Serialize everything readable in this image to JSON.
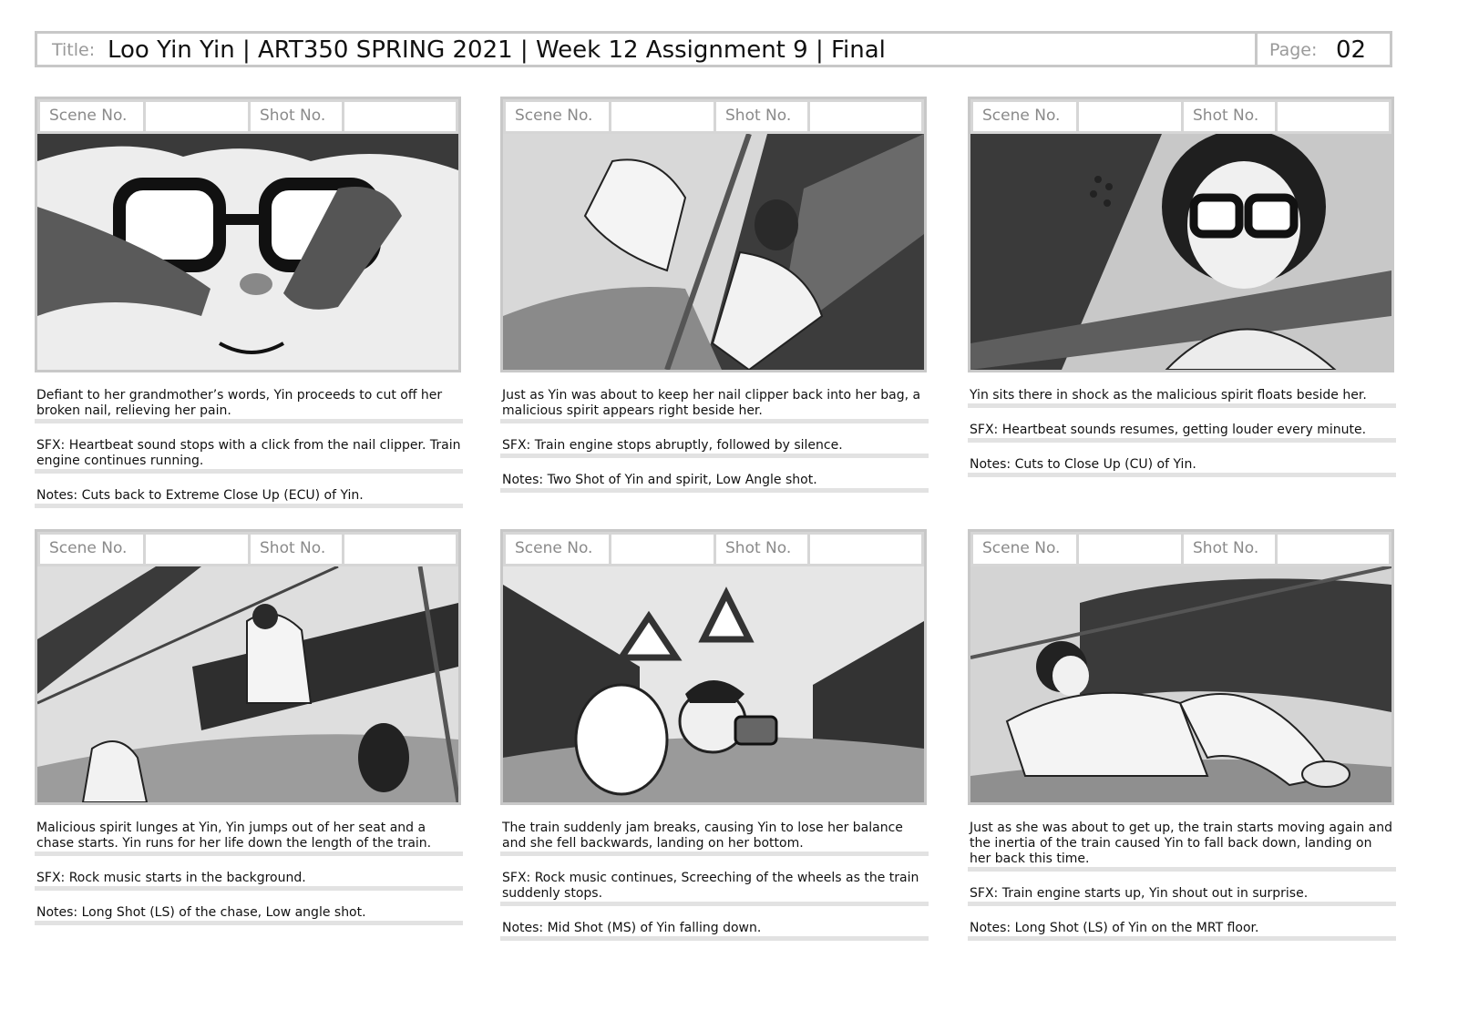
{
  "header": {
    "title_label": "Title:",
    "title": "Loo Yin Yin | ART350 SPRING 2021 | Week 12 Assignment 9 | Final",
    "page_label": "Page:",
    "page": "02"
  },
  "labels": {
    "scene": "Scene No.",
    "shot": "Shot No."
  },
  "panels": [
    {
      "description": "Defiant to her grandmother’s words, Yin proceeds to cut off her broken nail, relieving her pain.",
      "sfx": "SFX: Heartbeat sound stops with a click from the nail clipper. Train engine continues running.",
      "notes": "Notes: Cuts back to Extreme Close Up (ECU) of Yin."
    },
    {
      "description": "Just as Yin was about to keep her nail clipper back into her bag, a malicious spirit appears right beside her.",
      "sfx": "SFX: Train engine stops abruptly, followed by silence.",
      "notes": "Notes: Two Shot of Yin and spirit, Low Angle shot."
    },
    {
      "description": "Yin sits there in shock as the malicious spirit floats beside her.",
      "sfx": "SFX: Heartbeat sounds resumes, getting louder every minute.",
      "notes": "Notes: Cuts to Close Up (CU) of Yin."
    },
    {
      "description": "Malicious spirit lunges at Yin, Yin jumps out of her seat and a chase starts. Yin runs for her life down the length of the train.",
      "sfx": "SFX: Rock music starts in the background.",
      "notes": "Notes: Long Shot (LS) of the chase, Low angle shot."
    },
    {
      "description": "The train suddenly jam breaks, causing Yin to lose her balance and she fell backwards, landing on her bottom.",
      "sfx": "SFX: Rock music continues, Screeching of the wheels as the train suddenly stops.",
      "notes": "Notes: Mid Shot (MS) of Yin falling down."
    },
    {
      "description": "Just as she was about to get up, the train starts moving again and the inertia of the train caused Yin to fall back down, landing on her back this time.",
      "sfx": "SFX: Train engine starts up, Yin shout out in surprise.",
      "notes": "Notes: Long Shot (LS) of Yin on the MRT floor."
    }
  ]
}
